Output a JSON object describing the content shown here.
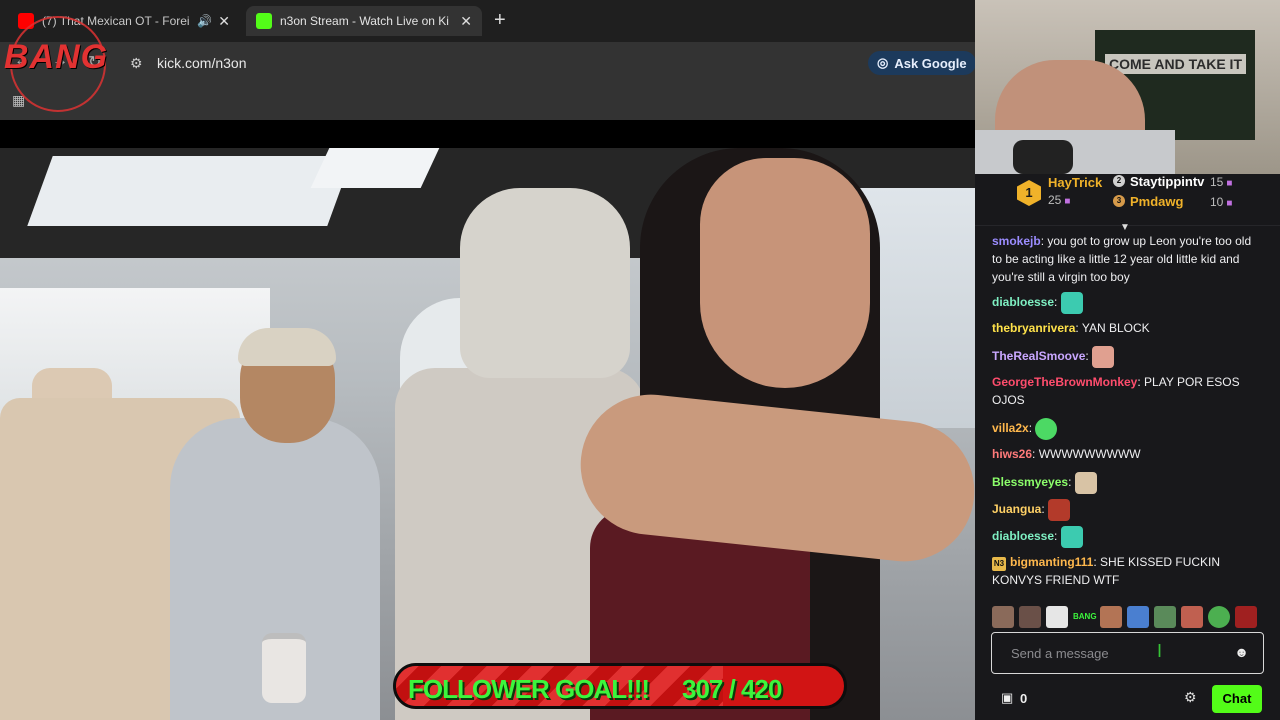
{
  "browser": {
    "tabs": [
      {
        "title": "(7) That Mexican OT - Forei",
        "favicon": "youtube-icon",
        "color": "#ff0000",
        "audio": true
      },
      {
        "title": "n3on Stream - Watch Live on Ki",
        "favicon": "kick-icon",
        "color": "#53fc18",
        "audio": false
      }
    ],
    "url": "kick.com/n3on",
    "ask_google": "Ask Google"
  },
  "overlay": {
    "bang_logo": "BANG"
  },
  "follower_goal": {
    "label": "FOLLOWER GOAL!!!",
    "count": "307 / 420",
    "current": 307,
    "target": 420
  },
  "webcam": {
    "sign": "COME AND TAKE IT"
  },
  "leaderboard": {
    "first": {
      "name": "HayTrick",
      "count": "25",
      "rank": "1",
      "color": "#f0b22a"
    },
    "second": {
      "name": "Staytippintv",
      "count": "15",
      "color": "#ffffff"
    },
    "third": {
      "name": "Pmdawg",
      "count": "10",
      "color": "#f0b22a"
    }
  },
  "messages": [
    {
      "user": "smokejb",
      "text": ": you got to grow up Leon you're too old to be acting like a little 12 year old little kid and you're still a virgin too boy",
      "color": "#9b8cff"
    },
    {
      "user": "diabloesse",
      "text": ":",
      "color": "#7ff0c3",
      "emote": true
    },
    {
      "user": "thebryanrivera",
      "text": ": YAN BLOCK",
      "color": "#ffe24a"
    },
    {
      "user": "TheRealSmoove",
      "text": ":",
      "color": "#c9a7ff",
      "emote": true
    },
    {
      "user": "GeorgeTheBrownMonkey",
      "text": ": PLAY POR ESOS OJOS",
      "color": "#ff4d6d"
    },
    {
      "user": "villa2x",
      "text": ":",
      "color": "#ffb84d",
      "emote": true
    },
    {
      "user": "hiws26",
      "text": ": WWWWWWWWW",
      "color": "#ff7a7a"
    },
    {
      "user": "Blessmyeyes",
      "text": ":",
      "color": "#8cff6b",
      "emote": true
    },
    {
      "user": "Juangua",
      "text": ":",
      "color": "#ffd166",
      "emote": true
    },
    {
      "user": "diabloesse",
      "text": ":",
      "color": "#7ff0c3",
      "emote": true
    },
    {
      "user": "bigmanting111",
      "text": ": SHE KISSED FUCKIN KONVYS FRIEND WTF",
      "color": "#ffb84d",
      "badge": "N3"
    }
  ],
  "emote_bar_label": "BANG",
  "input": {
    "placeholder": "Send a message"
  },
  "footer": {
    "vault_count": "0",
    "chat_button": "Chat"
  },
  "colors": {
    "kick_green": "#53fc18",
    "chat_bg": "#18181b"
  }
}
